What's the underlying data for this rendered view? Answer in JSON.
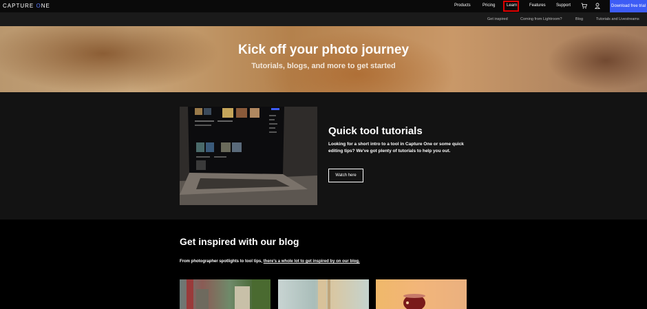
{
  "topnav": {
    "logo_left": "CAPTURE ",
    "logo_o": "O",
    "logo_right": "NE",
    "links": [
      "Products",
      "Pricing",
      "Learn",
      "Features",
      "Support"
    ],
    "download_label": "Download free trial",
    "highlight_color": "#e00000",
    "accent_color": "#3d5cf5"
  },
  "subnav": {
    "links": [
      "Get inspired",
      "Coming from Lightroom?",
      "Blog",
      "Tutorials and Livestreams"
    ]
  },
  "hero": {
    "title": "Kick off your photo journey",
    "subtitle": "Tutorials, blogs, and more to get started"
  },
  "tutorials": {
    "title": "Quick tool tutorials",
    "description": "Looking for a short intro to a tool in Capture One or some quick editing tips? We've got plenty of tutorials to help you out.",
    "button": "Watch here"
  },
  "blog": {
    "title": "Get inspired with our blog",
    "description_plain": "From photographer spotlights to tool tips, ",
    "description_link": "there's a whole lot to get inspired by on our blog."
  }
}
